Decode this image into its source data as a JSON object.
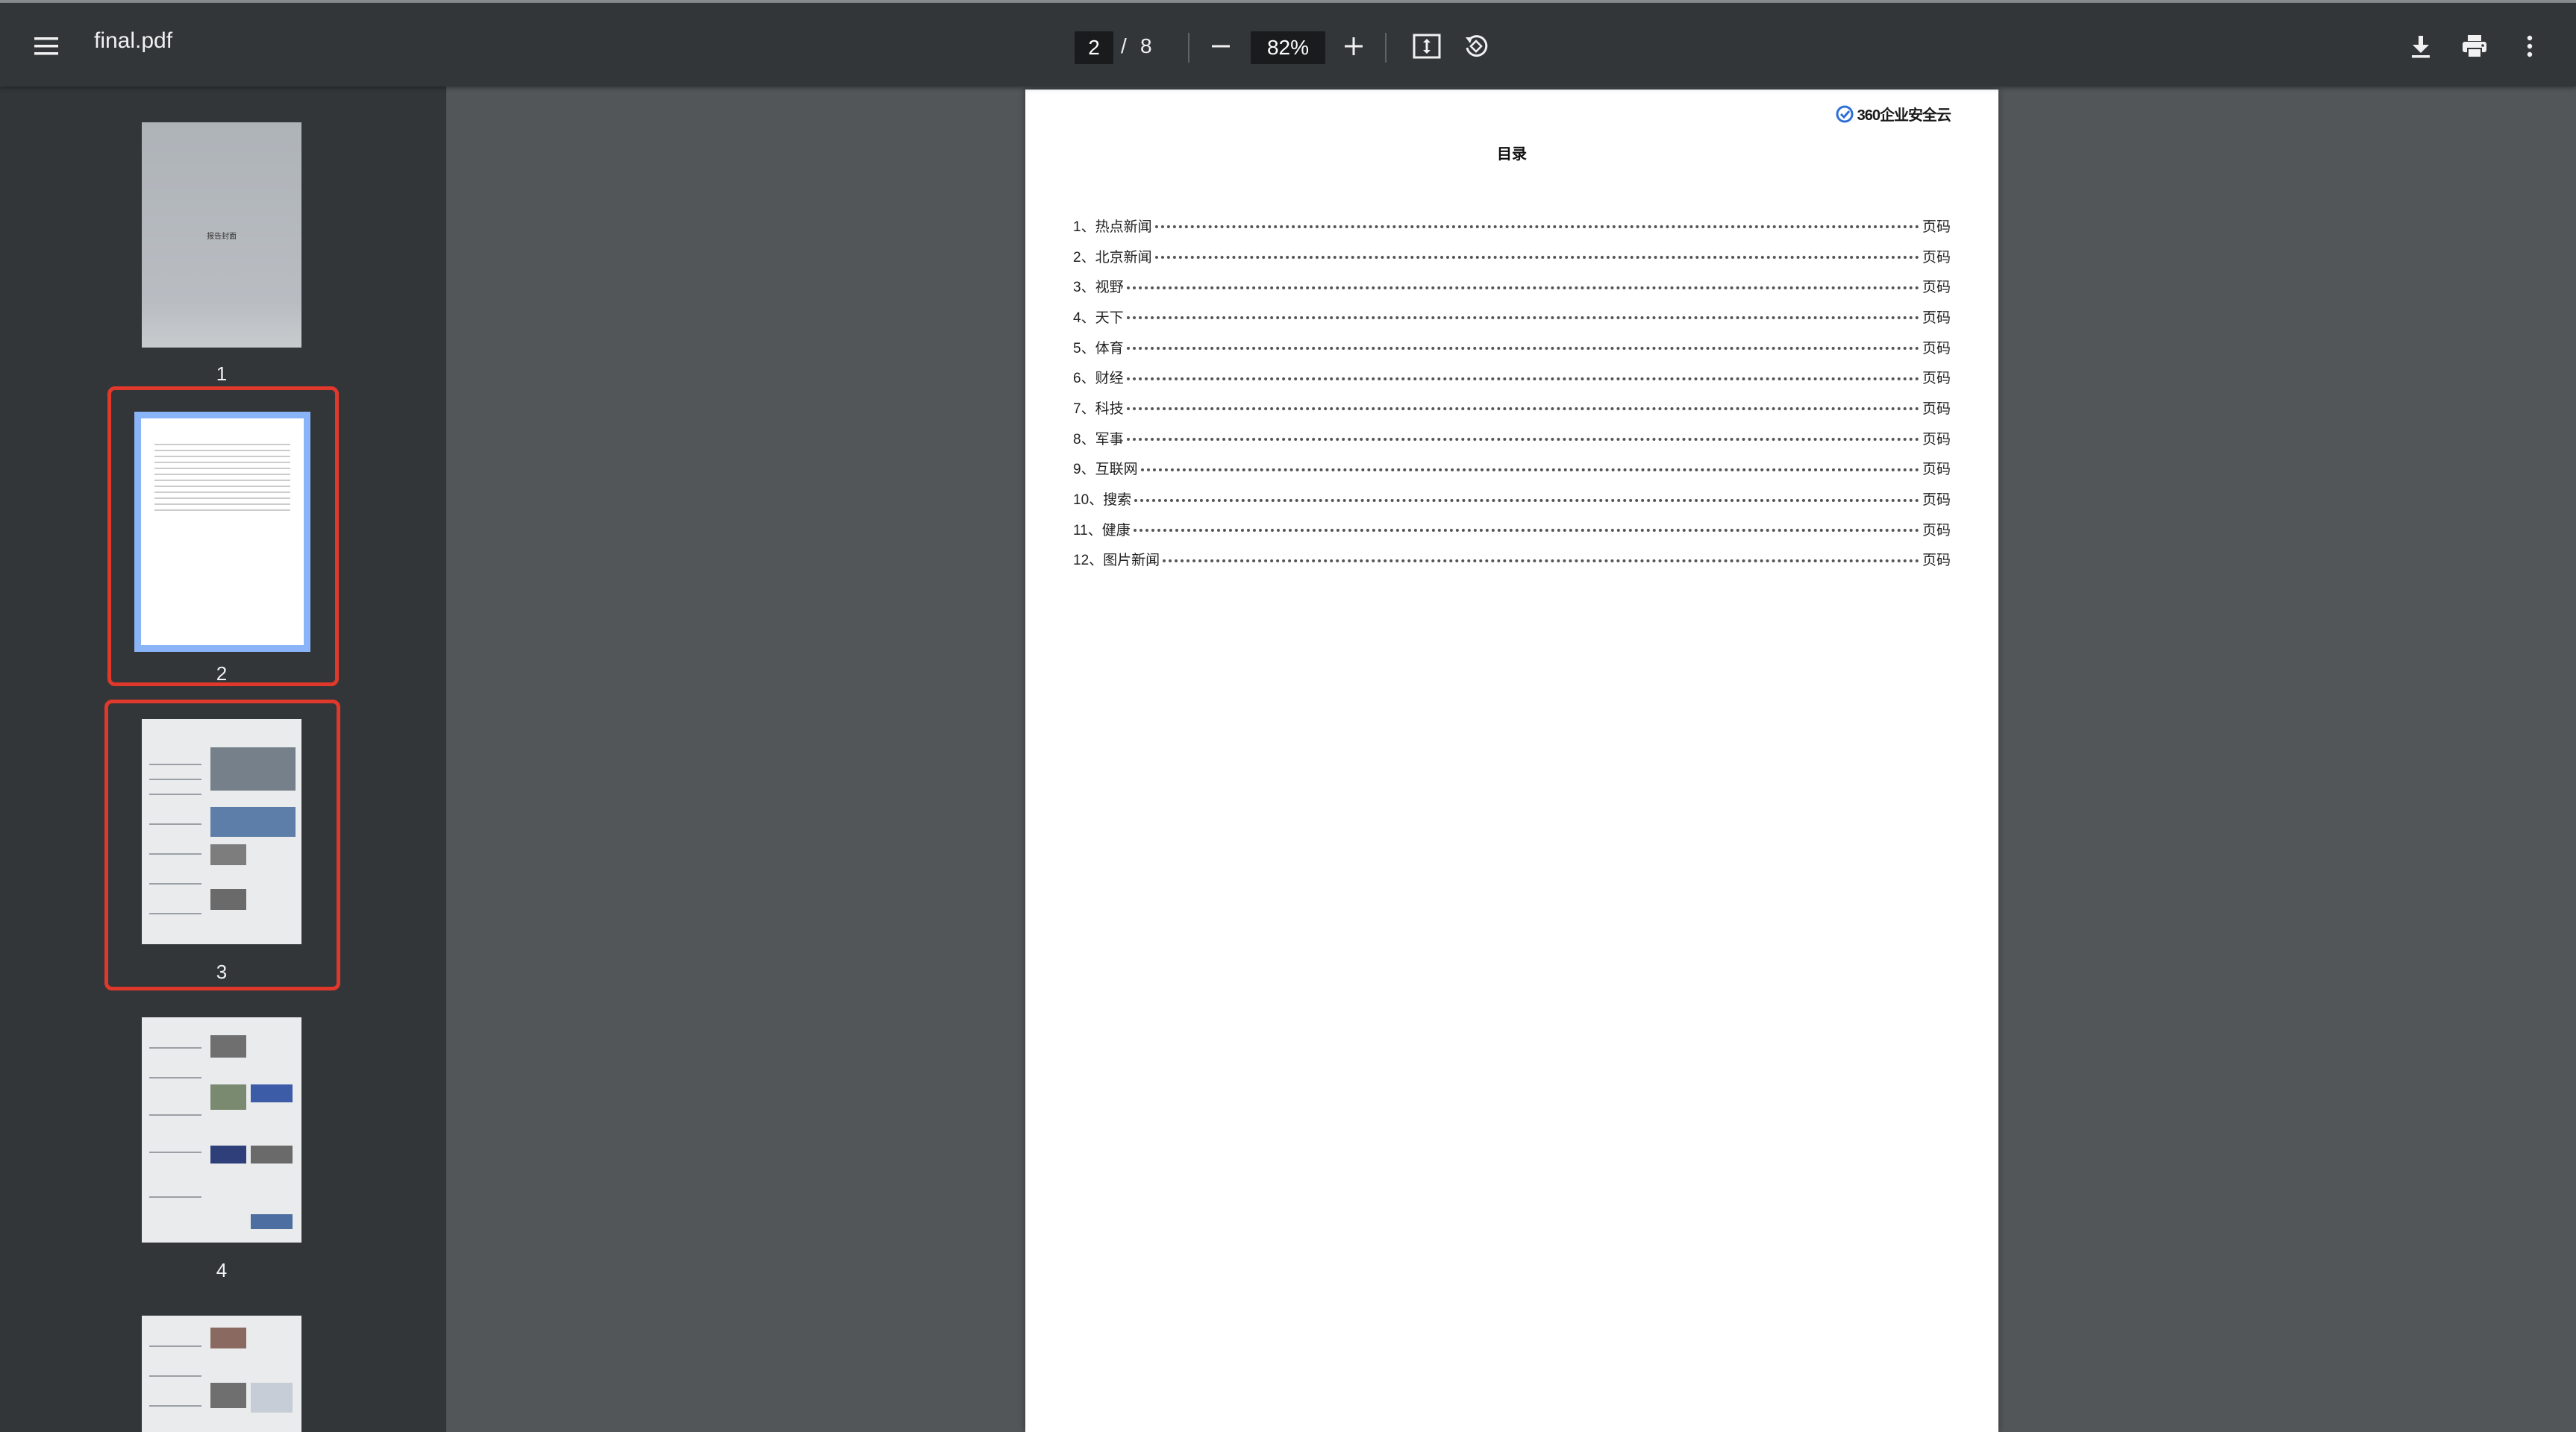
{
  "toolbar": {
    "file_name": "final.pdf",
    "current_page": "2",
    "separator": "/",
    "total_pages": "8",
    "zoom": "82%",
    "icons": [
      "menu-icon",
      "zoom-out-icon",
      "zoom-in-icon",
      "fit-page-icon",
      "rotate-icon",
      "download-icon",
      "print-icon",
      "more-vert-icon"
    ]
  },
  "sidebar": {
    "thumbnails": [
      {
        "number": "1",
        "label": "报告封面",
        "selected": false,
        "highlighted": false
      },
      {
        "number": "2",
        "selected": true,
        "highlighted": true
      },
      {
        "number": "3",
        "selected": false,
        "highlighted": true
      },
      {
        "number": "4",
        "selected": false,
        "highlighted": false
      },
      {
        "number": "5",
        "selected": false,
        "highlighted": false
      }
    ],
    "highlight_color": "#e0382b",
    "selected_color": "#8ab4f8"
  },
  "document": {
    "logo_text": "360企业安全云",
    "heading": "目录",
    "toc": [
      {
        "label": "1、热点新闻",
        "page": "页码"
      },
      {
        "label": "2、北京新闻",
        "page": "页码"
      },
      {
        "label": "3、视野",
        "page": "页码"
      },
      {
        "label": "4、天下",
        "page": "页码"
      },
      {
        "label": "5、体育",
        "page": "页码"
      },
      {
        "label": "6、财经",
        "page": "页码"
      },
      {
        "label": "7、科技",
        "page": "页码"
      },
      {
        "label": "8、军事",
        "page": "页码"
      },
      {
        "label": "9、互联网",
        "page": "页码"
      },
      {
        "label": "10、搜索",
        "page": "页码"
      },
      {
        "label": "11、健康",
        "page": "页码"
      },
      {
        "label": "12、图片新闻",
        "page": "页码"
      }
    ]
  }
}
